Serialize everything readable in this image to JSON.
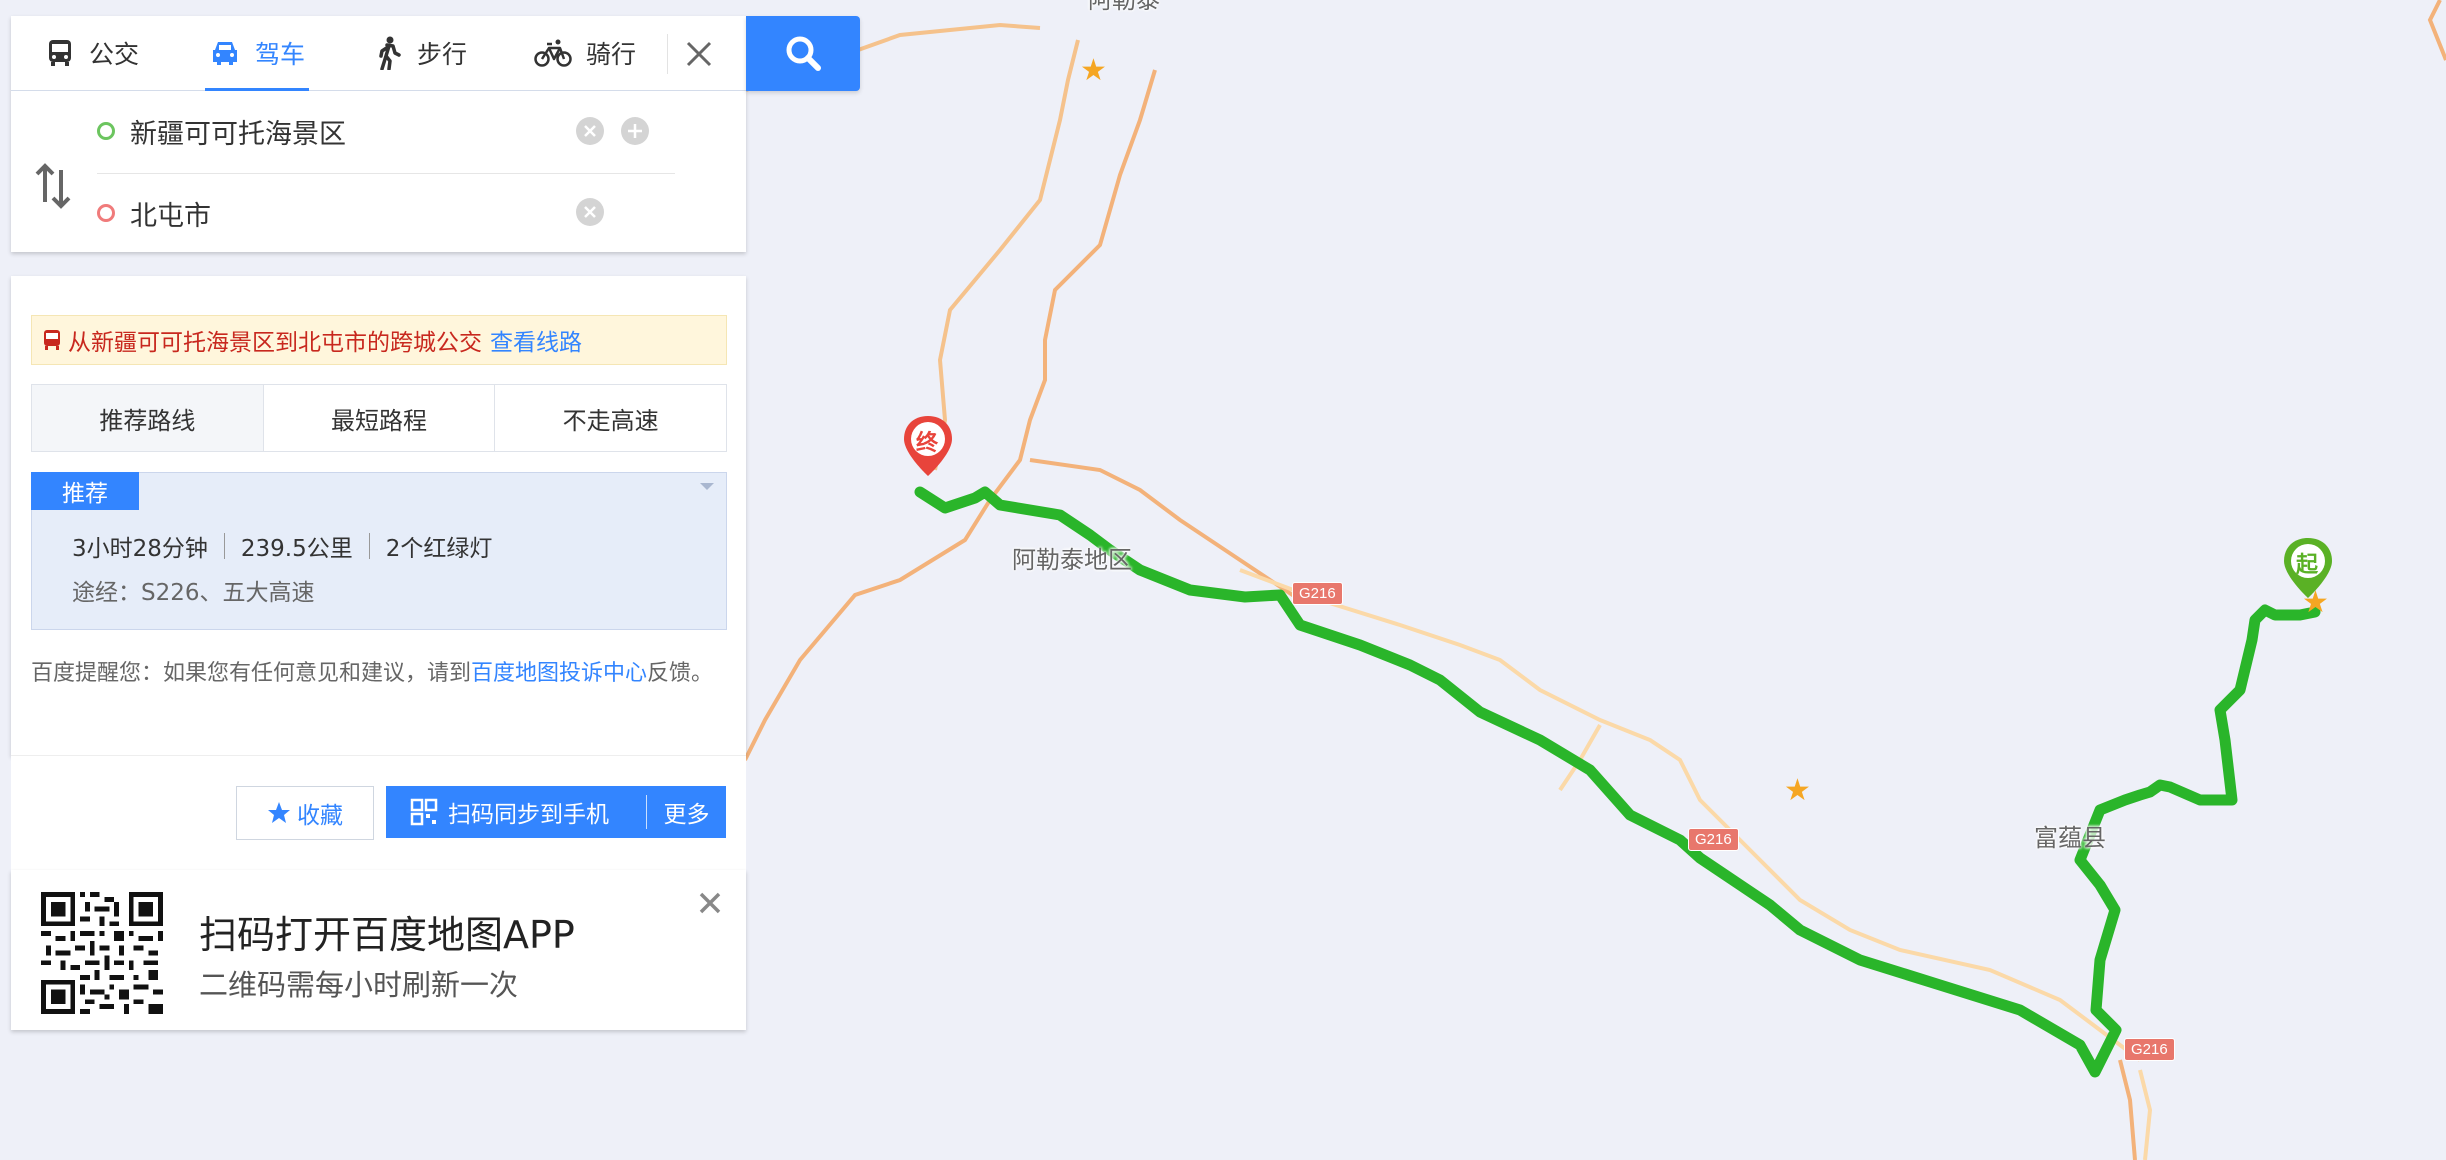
{
  "tabs": [
    {
      "label": "公交",
      "icon": "bus-icon"
    },
    {
      "label": "驾车",
      "icon": "car-icon",
      "active": true
    },
    {
      "label": "步行",
      "icon": "walk-icon"
    },
    {
      "label": "骑行",
      "icon": "bike-icon"
    }
  ],
  "origin": {
    "value": "新疆可可托海景区"
  },
  "destination": {
    "value": "北屯市"
  },
  "notice": {
    "text": "从新疆可可托海景区到北屯市的跨城公交",
    "link": "查看线路"
  },
  "route_tabs": [
    "推荐路线",
    "最短路程",
    "不走高速"
  ],
  "route": {
    "badge": "推荐",
    "duration": "3小时28分钟",
    "distance": "239.5公里",
    "lights": "2个红绿灯",
    "via": "途经：S226、五大高速"
  },
  "tip": {
    "prefix": "百度提醒您：如果您有任何意见和建议，请到",
    "link": "百度地图投诉中心",
    "suffix": "反馈。"
  },
  "actions": {
    "favorite": "收藏",
    "sync": "扫码同步到手机",
    "more": "更多"
  },
  "qr": {
    "title": "扫码打开百度地图APP",
    "subtitle": "二维码需每小时刷新一次"
  },
  "map": {
    "labels": {
      "altay_region": "阿勒泰地区",
      "fuyun": "富蕴县",
      "altay_top": "阿勒泰"
    },
    "shields": [
      "G216",
      "G216",
      "G216"
    ],
    "end_marker": "终",
    "start_marker": "起",
    "route_color": "#2ab52a",
    "accent": "#3385ff"
  }
}
